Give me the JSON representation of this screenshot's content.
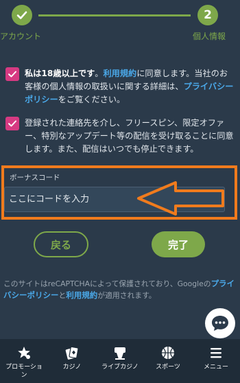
{
  "stepper": {
    "step1_icon": "check-icon",
    "step1_label": "アカウント",
    "step2_number": "2",
    "step2_label": "個人情報"
  },
  "consent": {
    "age": {
      "checked": true,
      "bold_text": "私は18歳以上です",
      "text_1": "。",
      "terms_link": "利用規約",
      "text_2": "に同意します。当社のお客様の個人情報の取扱いに関する詳細は、",
      "privacy_link": "プライバシーポリシー",
      "text_3": "をご覧ください。"
    },
    "marketing": {
      "checked": true,
      "text": "登録された連絡先を介し、フリースピン、限定オファー、特別なアップデート等の配信を受け取ることに同意します。また、配信はいつでも停止できます。"
    }
  },
  "bonus": {
    "label": "ボーナスコード",
    "placeholder": "ここにコードを入力"
  },
  "buttons": {
    "back": "戻る",
    "done": "完了"
  },
  "recaptcha": {
    "text_1": "このサイトはreCAPTCHAによって保護されており、Googleの",
    "privacy_link": "プライバシーポリシー",
    "text_2": "と",
    "terms_link": "利用規約",
    "text_3": "が適用されます。"
  },
  "chat": {
    "icon": "chat-bubble-icon"
  },
  "nav": {
    "items": [
      {
        "label": "プロモーション",
        "icon": "star-promo-icon"
      },
      {
        "label": "カジノ",
        "icon": "cards-icon"
      },
      {
        "label": "ライブカジノ",
        "icon": "live-casino-icon"
      },
      {
        "label": "スポーツ",
        "icon": "basketball-icon"
      },
      {
        "label": "メニュー",
        "icon": "menu-icon"
      }
    ]
  },
  "colors": {
    "background": "#2b3a4a",
    "accent_green": "#7ea84a",
    "checkbox_pink": "#d63a82",
    "link_blue": "#4aa8e8",
    "highlight_orange": "#f07b1d",
    "nav_background": "#1f2c38"
  }
}
